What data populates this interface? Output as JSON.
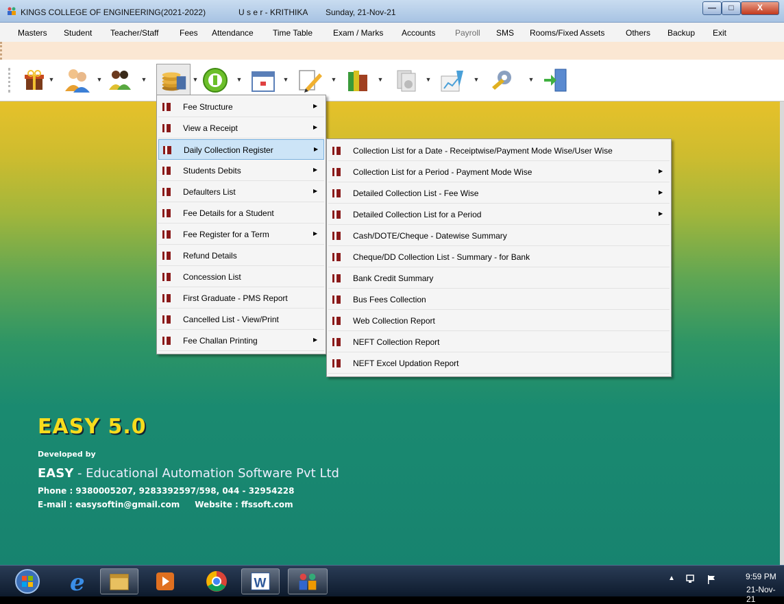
{
  "window": {
    "title": "KINGS COLLEGE OF ENGINEERING(2021-2022)",
    "user": "U s e r - KRITHIKA",
    "date": "Sunday, 21-Nov-21",
    "controls": {
      "minimize": "—",
      "maximize": "□",
      "close": "X"
    }
  },
  "menubar": [
    {
      "label": "Masters"
    },
    {
      "label": "Student"
    },
    {
      "label": "Teacher/Staff"
    },
    {
      "label": "Fees"
    },
    {
      "label": "Attendance"
    },
    {
      "label": "Time Table"
    },
    {
      "label": "Exam / Marks"
    },
    {
      "label": "Accounts"
    },
    {
      "label": "Payroll",
      "disabled": true
    },
    {
      "label": "SMS"
    },
    {
      "label": "Rooms/Fixed Assets"
    },
    {
      "label": "Others"
    },
    {
      "label": "Backup"
    },
    {
      "label": "Exit"
    }
  ],
  "toolbar": {
    "icons": [
      "gift-icon",
      "users-icon",
      "people-icon",
      "coins-icon",
      "green-circle-icon",
      "calendar-icon",
      "pencil-icon",
      "books-icon",
      "documents-icon",
      "chart-icon",
      "tools-icon",
      "exit-door-icon"
    ],
    "active": "coins-icon"
  },
  "fees_menu": {
    "items": [
      {
        "label": "Fee Structure",
        "submenu": true
      },
      {
        "label": "View a Receipt",
        "submenu": true
      },
      {
        "label": "Daily Collection Register",
        "submenu": true,
        "highlighted": true
      },
      {
        "label": "Students Debits",
        "submenu": true
      },
      {
        "label": "Defaulters List",
        "submenu": true
      },
      {
        "label": "Fee Details for a Student",
        "submenu": false
      },
      {
        "label": "Fee Register for a Term",
        "submenu": true
      },
      {
        "label": "Refund Details",
        "submenu": false
      },
      {
        "label": "Concession List",
        "submenu": false
      },
      {
        "label": "First Graduate - PMS Report",
        "submenu": false
      },
      {
        "label": "Cancelled List - View/Print",
        "submenu": false
      },
      {
        "label": "Fee Challan Printing",
        "submenu": true
      }
    ]
  },
  "daily_collection_submenu": {
    "items": [
      {
        "label": "Collection List for a Date - Receiptwise/Payment Mode Wise/User Wise",
        "submenu": false
      },
      {
        "label": "Collection List for a Period - Payment Mode Wise",
        "submenu": true
      },
      {
        "label": "Detailed Collection List - Fee Wise",
        "submenu": true
      },
      {
        "label": "Detailed Collection List for a Period",
        "submenu": true
      },
      {
        "label": "Cash/DOTE/Cheque - Datewise Summary",
        "submenu": false
      },
      {
        "label": "Cheque/DD Collection List - Summary - for Bank",
        "submenu": false
      },
      {
        "label": "Bank Credit Summary",
        "submenu": false
      },
      {
        "label": "Bus Fees Collection",
        "submenu": false
      },
      {
        "label": "Web Collection Report",
        "submenu": false
      },
      {
        "label": "NEFT Collection Report",
        "submenu": false
      },
      {
        "label": "NEFT Excel Updation Report",
        "submenu": false
      }
    ]
  },
  "branding": {
    "product": "EASY 5.0",
    "developed_by": "Developed by",
    "company_bold": "EASY",
    "company_rest": " - Educational Automation Software Pvt Ltd",
    "phone": "Phone : 9380005207, 9283392597/598,  044 - 32954228",
    "email": "E-mail : easysoftin@gmail.com",
    "website": "Website : ffssoft.com"
  },
  "taskbar": {
    "buttons": [
      "start-orb-icon",
      "internet-explorer-icon",
      "file-explorer-icon",
      "media-player-icon",
      "chrome-icon",
      "word-icon",
      "app-icon"
    ],
    "active": "app-icon",
    "tray_icons": [
      "tray-up-arrow-icon",
      "network-icon",
      "flag-icon"
    ],
    "time": "9:59 PM",
    "date": "21-Nov-21"
  },
  "colors": {
    "menu_highlight": "#cce4f7",
    "brand_yellow": "#f7dc1d",
    "background_top": "#e6c12a",
    "background_bottom": "#17836f"
  }
}
